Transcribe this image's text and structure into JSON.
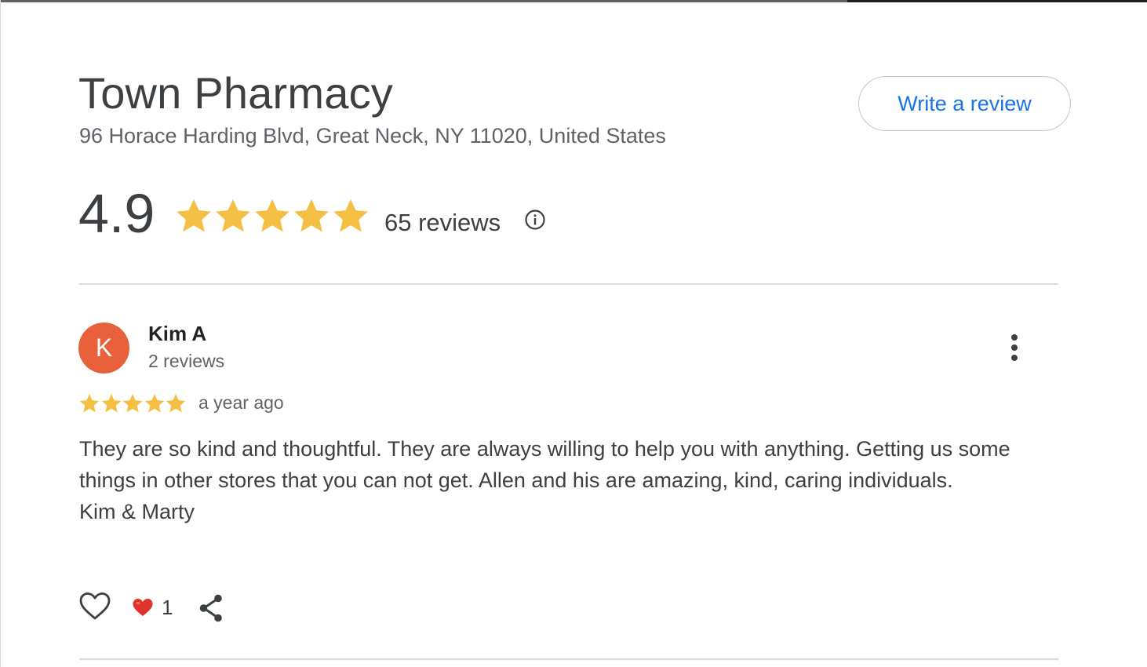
{
  "place": {
    "name": "Town Pharmacy",
    "address": "96 Horace Harding Blvd, Great Neck, NY 11020, United States"
  },
  "actions": {
    "write_review_label": "Write a review"
  },
  "summary": {
    "rating": "4.9",
    "stars": 5,
    "review_count": "65 reviews",
    "info_icon": "info-circle-icon"
  },
  "review": {
    "avatar_initial": "K",
    "reviewer_name": "Kim A",
    "reviewer_review_count": "2 reviews",
    "stars": 5,
    "time": "a year ago",
    "text_lines": [
      "They are so kind and thoughtful. They are always willing to help you with anything. Getting us some things in other stores that you can not get. Allen and his are amazing, kind, caring individuals.",
      "Kim & Marty"
    ],
    "reaction_count": "1",
    "icons": {
      "more": "more-vert-icon",
      "like": "heart-outline-icon",
      "reaction": "red-heart-emoji",
      "share": "share-icon"
    }
  },
  "colors": {
    "star": "#f4bf42",
    "accent_blue": "#1a73e8",
    "avatar_bg": "#e8603c",
    "text_primary": "#3c4043",
    "text_secondary": "#5f6368",
    "divider": "#dadce0",
    "reaction_red": "#e0332c"
  }
}
